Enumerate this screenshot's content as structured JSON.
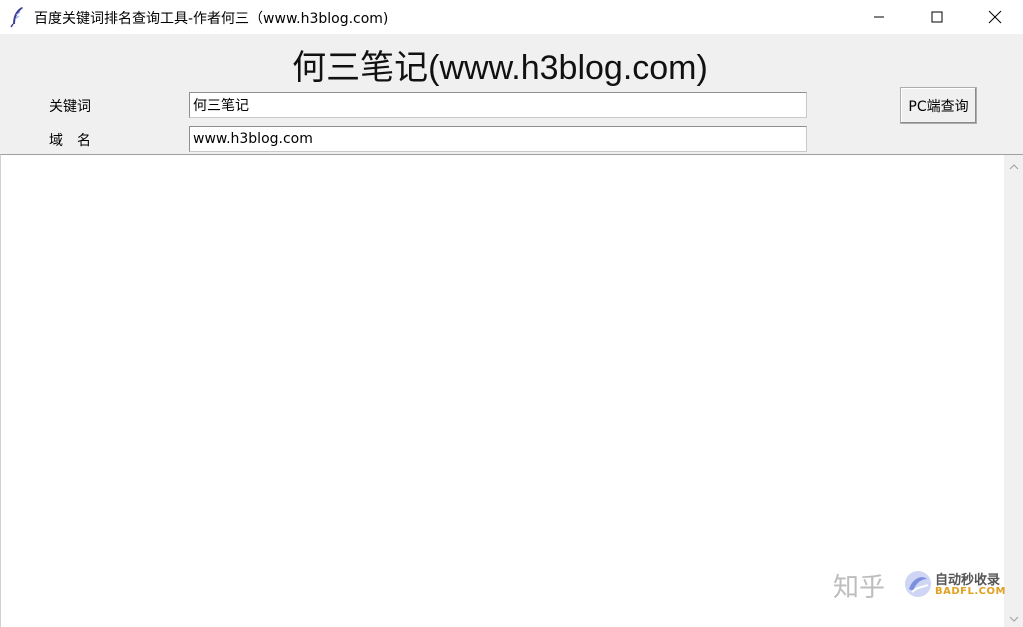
{
  "window": {
    "title": "百度关键词排名查询工具-作者何三（www.h3blog.com)"
  },
  "app": {
    "banner": "何三笔记(www.h3blog.com)",
    "keyword_label": "关键词",
    "keyword_value": "何三笔记",
    "domain_label": "域名",
    "domain_value": "www.h3blog.com",
    "query_button": "PC端查询"
  },
  "watermark": {
    "brand": "知乎",
    "line1": "自动秒收录",
    "line2": "BADFL.COM"
  },
  "colors": {
    "client_bg": "#f0f0f0",
    "watermark_accent": "#e0a020"
  },
  "icons": [
    "feather-icon",
    "minimize-icon",
    "maximize-icon",
    "close-icon",
    "scroll-up-icon",
    "scroll-down-icon"
  ]
}
